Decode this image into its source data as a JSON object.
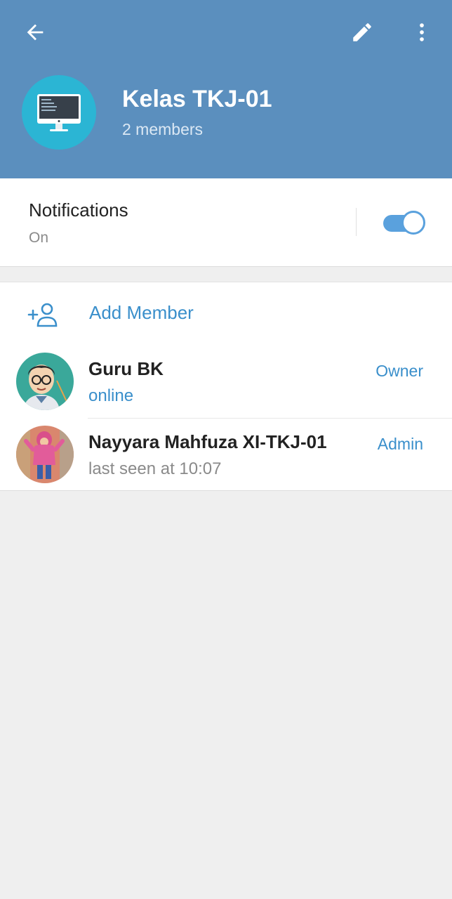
{
  "header": {
    "title": "Kelas TKJ-01",
    "subtitle": "2 members",
    "back_icon": "arrow-left-icon",
    "edit_icon": "pencil-icon",
    "more_icon": "more-vertical-icon",
    "background": "#5b8fbe"
  },
  "notifications": {
    "label": "Notifications",
    "value": "On",
    "enabled": true
  },
  "members_section": {
    "add_member_label": "Add Member",
    "add_member_icon": "add-person-icon",
    "members": [
      {
        "name": "Guru BK",
        "status": "online",
        "role": "Owner"
      },
      {
        "name": "Nayyara Mahfuza XI-TKJ-01",
        "status": "last seen at 10:07",
        "role": "Admin"
      }
    ]
  },
  "colors": {
    "accent": "#3a8fcb",
    "toggle": "#5aa1dd",
    "page_bg": "#efefef"
  }
}
